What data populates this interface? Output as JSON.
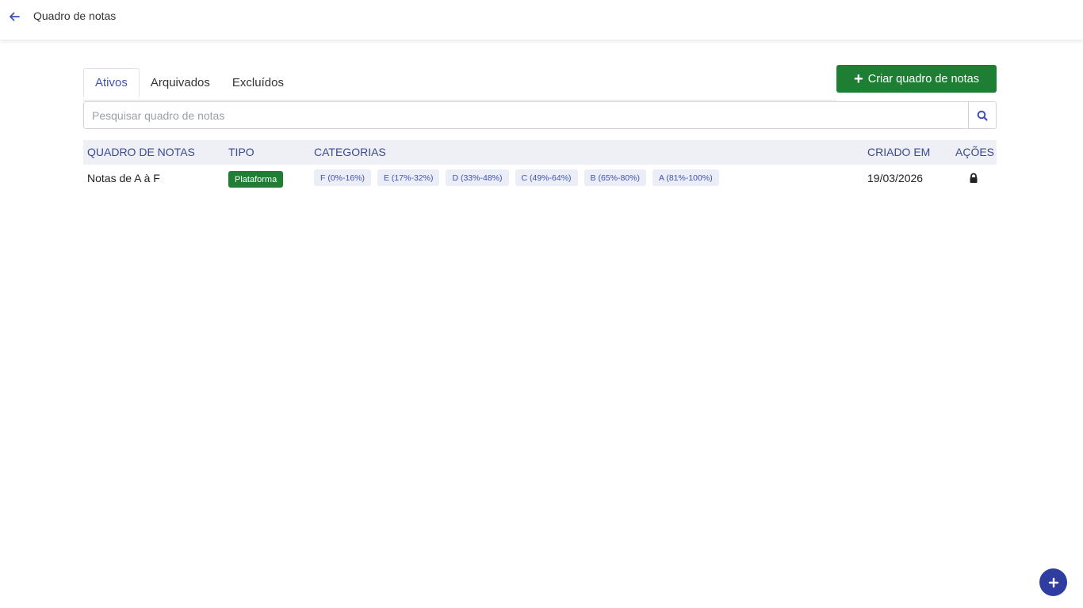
{
  "header": {
    "back_icon": "arrow-left-icon",
    "title": "Quadro de notas"
  },
  "tabs": [
    {
      "label": "Ativos",
      "active": true
    },
    {
      "label": "Arquivados",
      "active": false
    },
    {
      "label": "Excluídos",
      "active": false
    }
  ],
  "create_button": {
    "label": "Criar quadro de notas",
    "icon": "plus-icon"
  },
  "search": {
    "placeholder": "Pesquisar quadro de notas",
    "value": "",
    "icon": "search-icon"
  },
  "table": {
    "headers": [
      "QUADRO DE NOTAS",
      "TIPO",
      "CATEGORIAS",
      "CRIADO EM",
      "AÇÕES"
    ],
    "rows": [
      {
        "name": "Notas de A à F",
        "tipo": "Plataforma",
        "categorias": [
          "F (0%-16%)",
          "E (17%-32%)",
          "D (33%-48%)",
          "C (49%-64%)",
          "B (65%-80%)",
          "A (81%-100%)"
        ],
        "criado_em": "19/03/2026",
        "acao_icon": "lock-icon"
      }
    ]
  },
  "fab": {
    "icon": "plus-icon"
  },
  "colors": {
    "accent": "#3f51b5",
    "success": "#1e7e34",
    "header_bg": "#eff0f5",
    "fab": "#2f3e9e"
  }
}
